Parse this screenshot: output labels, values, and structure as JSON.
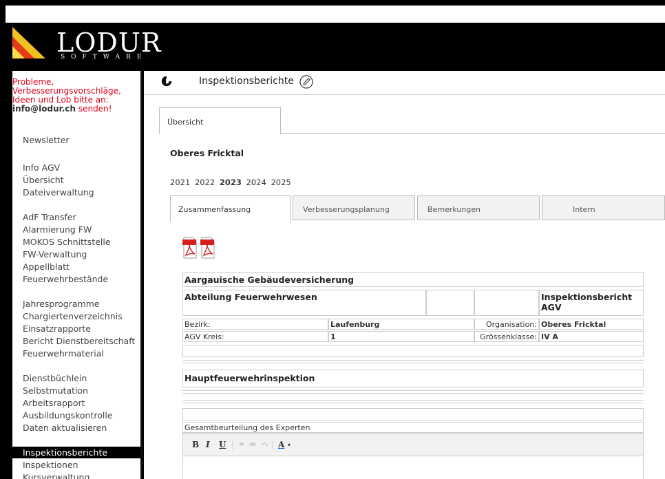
{
  "brand": {
    "logo_text": "LODUR",
    "logo_sub": "SOFTWARE"
  },
  "sidebar": {
    "notice_line1": "Probleme,",
    "notice_line2": "Verbesserungsvorschläge,",
    "notice_line3": "Ideen und Lob bitte an:",
    "notice_email": "info@lodur.ch",
    "notice_suffix": " senden!",
    "items": [
      {
        "label": "Newsletter"
      },
      {
        "label": "Info AGV"
      },
      {
        "label": "Übersicht"
      },
      {
        "label": "Dateiverwaltung"
      },
      {
        "label": "AdF Transfer"
      },
      {
        "label": "Alarmierung FW"
      },
      {
        "label": "MOKOS Schnittstelle"
      },
      {
        "label": "FW-Verwaltung"
      },
      {
        "label": "Appellblatt"
      },
      {
        "label": "Feuerwehrbestände"
      },
      {
        "label": "Jahresprogramme"
      },
      {
        "label": "Chargiertenverzeichnis"
      },
      {
        "label": "Einsatzrapporte"
      },
      {
        "label": "Bericht Dienstbereitschaft"
      },
      {
        "label": "Feuerwehrmaterial"
      },
      {
        "label": "Dienstbüchlein"
      },
      {
        "label": "Selbstmutation"
      },
      {
        "label": "Arbeitsrapport"
      },
      {
        "label": "Ausbildungskontrolle"
      },
      {
        "label": "Daten aktualisieren"
      },
      {
        "label": "Inspektionsberichte"
      },
      {
        "label": "Inspektionen"
      },
      {
        "label": "Kursverwaltung"
      }
    ]
  },
  "main": {
    "title": "Inspektionsberichte",
    "tab_overview": "Übersicht",
    "region": "Oberes Fricktal",
    "years": [
      "2021",
      "2022",
      "2023",
      "2024",
      "2025"
    ],
    "current_year": "2023",
    "subtabs": [
      "Zusammenfassung",
      "Verbesserungsplanung",
      "Bemerkungen",
      "Intern"
    ],
    "report": {
      "org_title": "Aargauische Gebäudeversicherung",
      "dept": "Abteilung Feuerwehrwesen",
      "report_title_1": "Inspektionsbericht",
      "report_title_2": "AGV",
      "bezirk_label": "Bezirk:",
      "bezirk_value": "Laufenburg",
      "organisation_label": "Organisation:",
      "organisation_value": "Oberes Fricktal",
      "kreis_label": "AGV Kreis:",
      "kreis_value": "1",
      "groesse_label": "Grössenklasse:",
      "groesse_value": "IV A",
      "section_title": "Hauptfeuerwehrinspektion",
      "assessment_label": "Gesamtbeurteilung des Experten"
    },
    "editor_toolbar": {
      "bold": "B",
      "italic": "I",
      "underline": "U",
      "color": "A"
    }
  }
}
